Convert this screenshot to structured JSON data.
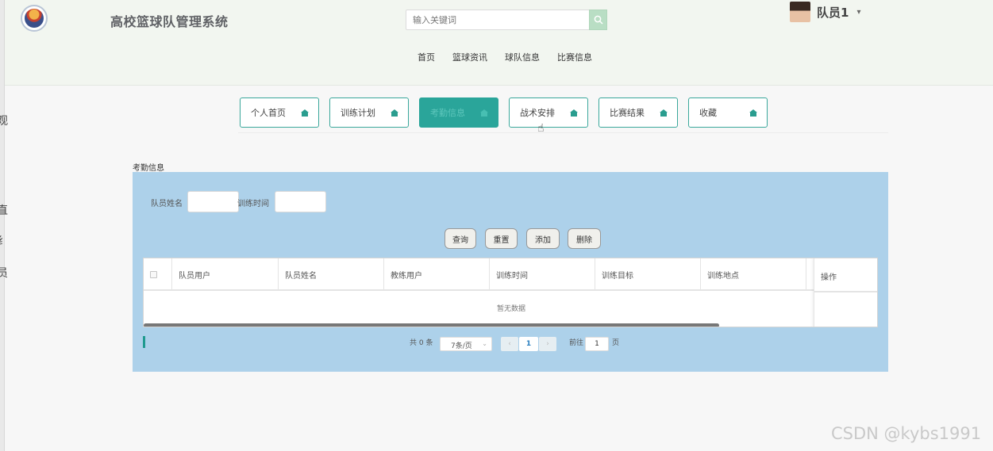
{
  "header": {
    "site_title": "高校篮球队管理系统",
    "search_placeholder": "输入关键词",
    "user_name": "队员1",
    "nav": [
      "首页",
      "篮球资讯",
      "球队信息",
      "比赛信息"
    ]
  },
  "tabs": [
    {
      "label": "个人首页",
      "active": false
    },
    {
      "label": "训练计划",
      "active": false
    },
    {
      "label": "考勤信息",
      "active": true
    },
    {
      "label": "战术安排",
      "active": false
    },
    {
      "label": "比赛结果",
      "active": false
    },
    {
      "label": "收藏",
      "active": false
    }
  ],
  "section_title": "考勤信息",
  "filters": {
    "name_label": "队员姓名",
    "time_label": "训练时间"
  },
  "buttons": {
    "query": "查询",
    "reset": "重置",
    "add": "添加",
    "delete": "删除"
  },
  "table": {
    "columns": [
      "队员用户",
      "队员姓名",
      "教练用户",
      "训练时间",
      "训练目标",
      "训练地点"
    ],
    "op_column": "操作",
    "empty_text": "暂无数据"
  },
  "pagination": {
    "total_text": "共 0 条",
    "page_size": "7条/页",
    "current_page": "1",
    "goto_label": "前往",
    "goto_value": "1",
    "page_suffix": "页"
  },
  "left_edge_glyphs": [
    "观",
    "·",
    "·",
    "直",
    "纟",
    "员",
    "·",
    "·",
    "·",
    "·",
    "·"
  ],
  "watermark": "CSDN @kybs1991",
  "colors": {
    "accent": "#2aa59a",
    "panel": "#add1ea",
    "header_bg": "#f2f6f0"
  }
}
